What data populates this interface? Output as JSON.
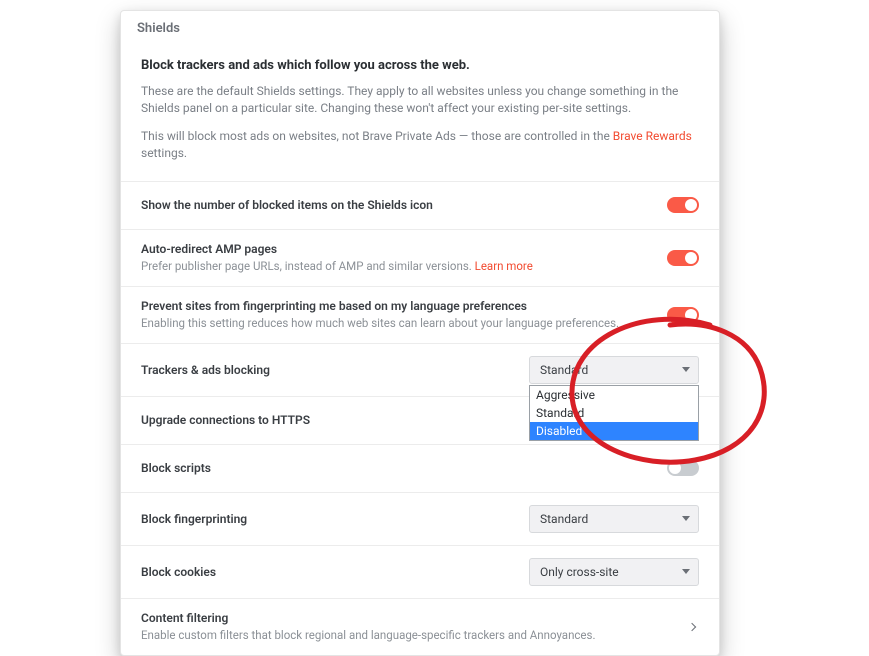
{
  "header": {
    "section_title": "Shields"
  },
  "intro": {
    "title": "Block trackers and ads which follow you across the web.",
    "p1": "These are the default Shields settings. They apply to all websites unless you change something in the Shields panel on a particular site. Changing these won't affect your existing per-site settings.",
    "p2_pre": "This will block most ads on websites, not Brave Private Ads — those are controlled in the ",
    "p2_link": "Brave Rewards",
    "p2_post": " settings."
  },
  "rows": {
    "show_count": {
      "label": "Show the number of blocked items on the Shields icon",
      "toggle": true
    },
    "amp": {
      "label": "Auto-redirect AMP pages",
      "desc_pre": "Prefer publisher page URLs, instead of AMP and similar versions.  ",
      "desc_link": "Learn more",
      "toggle": true
    },
    "lang_fp": {
      "label": "Prevent sites from fingerprinting me based on my language preferences",
      "desc": "Enabling this setting reduces how much web sites can learn about your language preferences.",
      "toggle": true
    },
    "trackers": {
      "label": "Trackers & ads blocking",
      "select": {
        "value": "Standard",
        "options": [
          "Aggressive",
          "Standard",
          "Disabled"
        ],
        "selected_option": "Disabled",
        "open": true
      }
    },
    "https": {
      "label": "Upgrade connections to HTTPS"
    },
    "scripts": {
      "label": "Block scripts",
      "toggle": false
    },
    "fingerprinting": {
      "label": "Block fingerprinting",
      "select": {
        "value": "Standard"
      }
    },
    "cookies": {
      "label": "Block cookies",
      "select": {
        "value": "Only cross-site"
      }
    },
    "filtering": {
      "label": "Content filtering",
      "desc": "Enable custom filters that block regional and language-specific trackers and Annoyances."
    }
  },
  "colors": {
    "accent": "#fa5a47",
    "link": "#f24a2f",
    "dropdown_highlight": "#2e84ff",
    "annotation": "#d81f26"
  }
}
